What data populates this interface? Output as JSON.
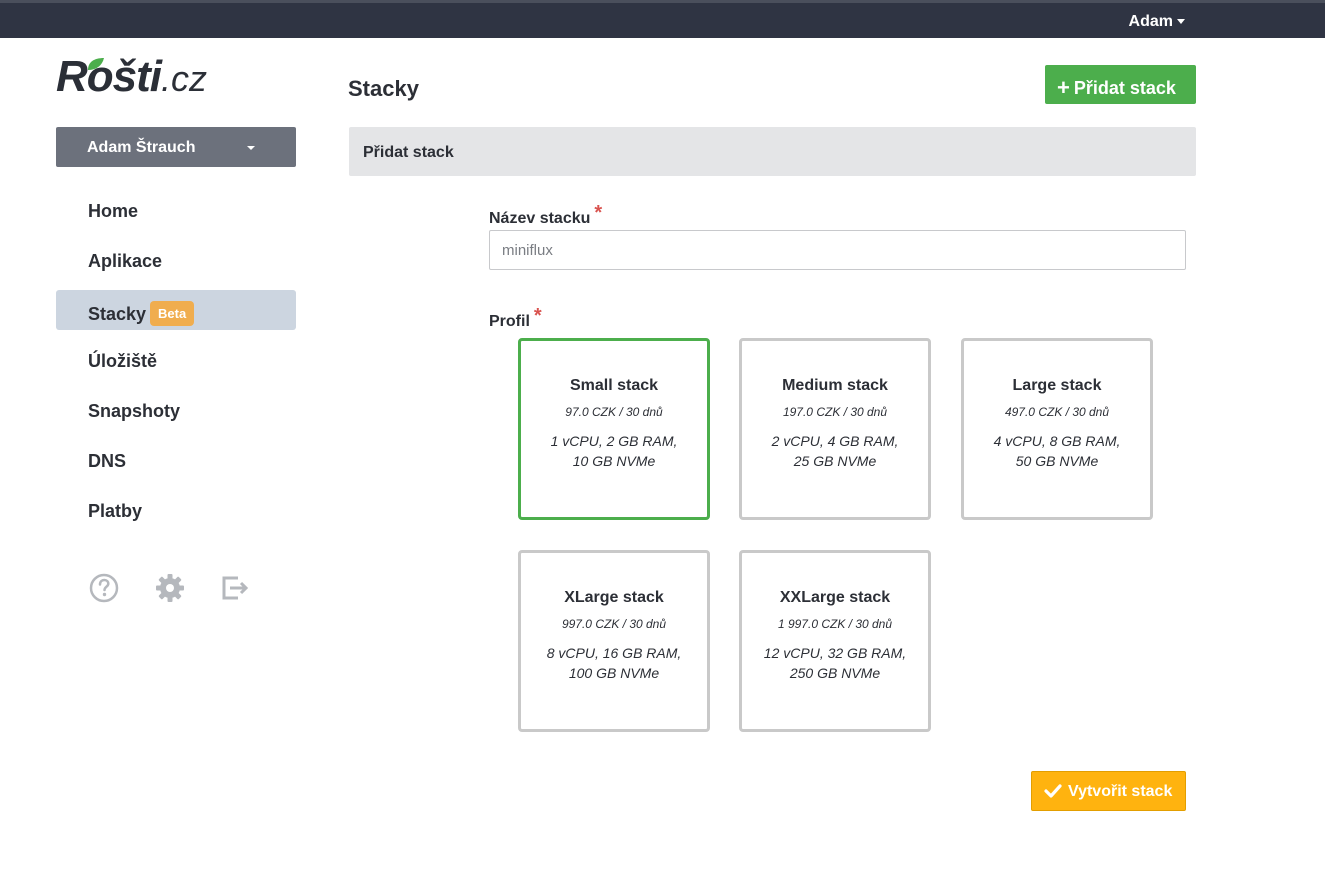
{
  "topbar": {
    "user": "Adam"
  },
  "logo": {
    "brand": "Rošti",
    "tld": ".cz"
  },
  "account": {
    "name": "Adam Štrauch"
  },
  "nav": [
    {
      "label": "Home",
      "active": false
    },
    {
      "label": "Aplikace",
      "active": false
    },
    {
      "label": "Stacky",
      "active": true,
      "badge": "Beta"
    },
    {
      "label": "Úložiště",
      "active": false
    },
    {
      "label": "Snapshoty",
      "active": false
    },
    {
      "label": "DNS",
      "active": false
    },
    {
      "label": "Platby",
      "active": false
    }
  ],
  "side_icons": [
    "help-icon",
    "gear-icon",
    "logout-icon"
  ],
  "page": {
    "title": "Stacky",
    "add_button": "Přidat stack"
  },
  "panel": {
    "title": "Přidat stack"
  },
  "form": {
    "name_label": "Název stacku",
    "required_mark": "*",
    "name_value": "miniflux",
    "profile_label": "Profil",
    "submit": "Vytvořit stack"
  },
  "profiles": [
    {
      "name": "Small stack",
      "price": "97.0 CZK / 30 dnů",
      "spec1": "1 vCPU, 2 GB RAM,",
      "spec2": "10 GB NVMe",
      "selected": true
    },
    {
      "name": "Medium stack",
      "price": "197.0 CZK / 30 dnů",
      "spec1": "2 vCPU, 4 GB RAM,",
      "spec2": "25 GB NVMe",
      "selected": false
    },
    {
      "name": "Large stack",
      "price": "497.0 CZK / 30 dnů",
      "spec1": "4 vCPU, 8 GB RAM,",
      "spec2": "50 GB NVMe",
      "selected": false
    },
    {
      "name": "XLarge stack",
      "price": "997.0 CZK / 30 dnů",
      "spec1": "8 vCPU, 16 GB RAM,",
      "spec2": "100 GB NVMe",
      "selected": false
    },
    {
      "name": "XXLarge stack",
      "price": "1 997.0 CZK / 30 dnů",
      "spec1": "12 vCPU, 32 GB RAM,",
      "spec2": "250 GB NVMe",
      "selected": false
    }
  ],
  "colors": {
    "topbar": "#2f3443",
    "accent_green": "#4cae4c",
    "accent_orange": "#ffb30f",
    "badge": "#f0ad4e",
    "active_nav": "#ccd5e0"
  }
}
